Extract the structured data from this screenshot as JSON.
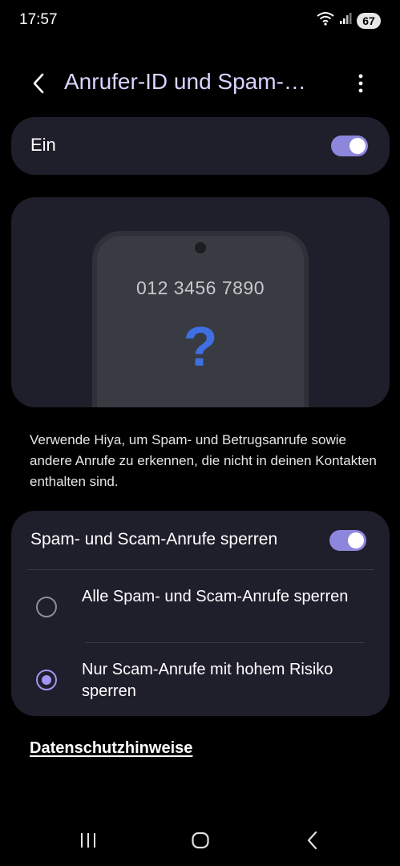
{
  "status_bar": {
    "time": "17:57",
    "battery": "67",
    "icons": [
      "wifi-icon",
      "signal-icon",
      "battery-icon"
    ]
  },
  "header": {
    "title": "Anrufer-ID und Spam-Sc...",
    "back_icon": "chevron-left-icon",
    "more_icon": "more-vertical-icon"
  },
  "master_switch": {
    "label": "Ein",
    "enabled": true
  },
  "illustration": {
    "phone_number": "012 3456 7890",
    "symbol": "?"
  },
  "description": "Verwende Hiya, um Spam- und Betrugsanrufe sowie andere Anrufe zu erkennen, die nicht in deinen Kontakten enthalten sind.",
  "block_section": {
    "label": "Spam- und Scam-Anrufe sperren",
    "enabled": true,
    "options": [
      {
        "label": "Alle Spam- und Scam-Anrufe sperren",
        "selected": false
      },
      {
        "label": "Nur Scam-Anrufe mit hohem Risiko sperren",
        "selected": true
      }
    ]
  },
  "privacy_link": "Datenschutzhinweise",
  "colors": {
    "accent": "#8c87dc",
    "title": "#d8d4ff",
    "card": "#1f1e2b",
    "question_mark": "#3f6fe0"
  },
  "navbar": {
    "icons": [
      "recents-icon",
      "home-icon",
      "back-icon"
    ]
  }
}
